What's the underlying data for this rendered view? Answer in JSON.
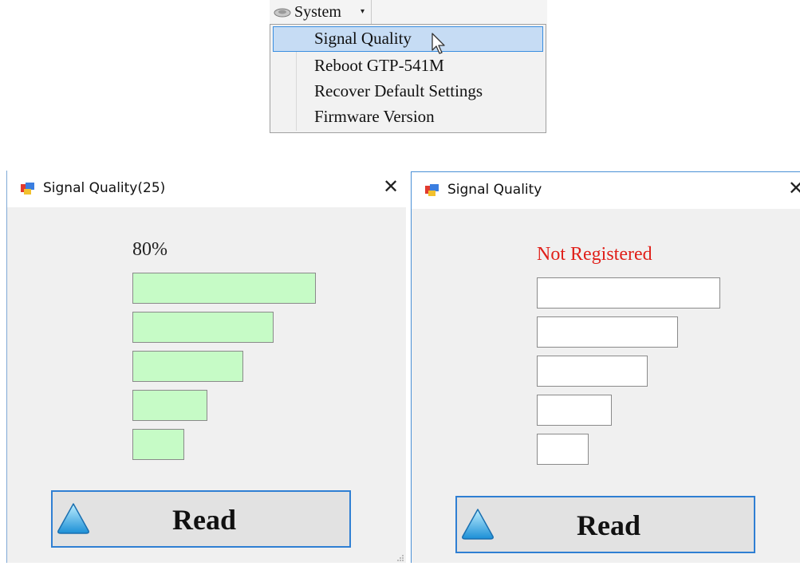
{
  "menu": {
    "menubar_label": "System",
    "items": [
      {
        "label": "Signal Quality",
        "highlighted": true
      },
      {
        "label": "Reboot GTP-541M",
        "highlighted": false
      },
      {
        "label": "Recover Default Settings",
        "highlighted": false
      },
      {
        "label": "Firmware Version",
        "highlighted": false
      }
    ]
  },
  "dialog_left": {
    "title": "Signal Quality(25)",
    "close_glyph": "✕",
    "signal_text": "80%",
    "signal_color": "#222222",
    "bars_active": [
      true,
      true,
      true,
      true,
      true
    ],
    "read_label": "Read"
  },
  "dialog_right": {
    "title": "Signal Quality",
    "close_glyph": "✕",
    "signal_text": "Not Registered",
    "signal_color": "#e0201a",
    "bars_active": [
      false,
      false,
      false,
      false,
      false
    ],
    "read_label": "Read"
  },
  "colors": {
    "bar_on": "#c6fbc6",
    "bar_off": "#ffffff",
    "button_border": "#2f7fd3",
    "menu_highlight": "#c6dcf4"
  },
  "icons": [
    "system-icon",
    "dropdown-arrow-icon",
    "cursor-icon",
    "app-icon",
    "close-icon",
    "up-arrow-icon"
  ]
}
